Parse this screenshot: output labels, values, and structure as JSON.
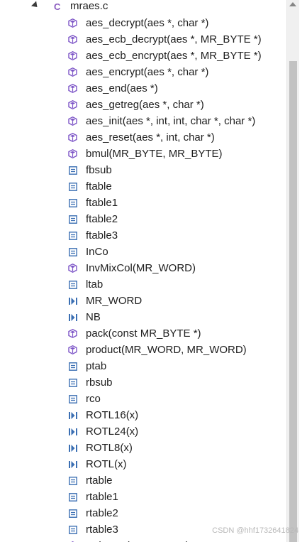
{
  "file": {
    "name": "mraes.c",
    "icon": "c-file-icon"
  },
  "colors": {
    "function": "#7d55c7",
    "variable": "#3b6fb3",
    "macro": "#3b6fb3"
  },
  "items": [
    {
      "label": "aes_decrypt(aes *, char *)",
      "kind": "function"
    },
    {
      "label": "aes_ecb_decrypt(aes *, MR_BYTE *)",
      "kind": "function"
    },
    {
      "label": "aes_ecb_encrypt(aes *, MR_BYTE *)",
      "kind": "function"
    },
    {
      "label": "aes_encrypt(aes *, char *)",
      "kind": "function"
    },
    {
      "label": "aes_end(aes *)",
      "kind": "function"
    },
    {
      "label": "aes_getreg(aes *, char *)",
      "kind": "function"
    },
    {
      "label": "aes_init(aes *, int, int, char *, char *)",
      "kind": "function"
    },
    {
      "label": "aes_reset(aes *, int, char *)",
      "kind": "function"
    },
    {
      "label": "bmul(MR_BYTE, MR_BYTE)",
      "kind": "function"
    },
    {
      "label": "fbsub",
      "kind": "variable"
    },
    {
      "label": "ftable",
      "kind": "variable"
    },
    {
      "label": "ftable1",
      "kind": "variable"
    },
    {
      "label": "ftable2",
      "kind": "variable"
    },
    {
      "label": "ftable3",
      "kind": "variable"
    },
    {
      "label": "InCo",
      "kind": "variable"
    },
    {
      "label": "InvMixCol(MR_WORD)",
      "kind": "function"
    },
    {
      "label": "ltab",
      "kind": "variable"
    },
    {
      "label": "MR_WORD",
      "kind": "macro"
    },
    {
      "label": "NB",
      "kind": "macro"
    },
    {
      "label": "pack(const MR_BYTE *)",
      "kind": "function"
    },
    {
      "label": "product(MR_WORD, MR_WORD)",
      "kind": "function"
    },
    {
      "label": "ptab",
      "kind": "variable"
    },
    {
      "label": "rbsub",
      "kind": "variable"
    },
    {
      "label": "rco",
      "kind": "variable"
    },
    {
      "label": "ROTL16(x)",
      "kind": "macro"
    },
    {
      "label": "ROTL24(x)",
      "kind": "macro"
    },
    {
      "label": "ROTL8(x)",
      "kind": "macro"
    },
    {
      "label": "ROTL(x)",
      "kind": "macro"
    },
    {
      "label": "rtable",
      "kind": "variable"
    },
    {
      "label": "rtable1",
      "kind": "variable"
    },
    {
      "label": "rtable2",
      "kind": "variable"
    },
    {
      "label": "rtable3",
      "kind": "variable"
    },
    {
      "label": "SubByte(MR_WORD)",
      "kind": "function"
    }
  ],
  "watermark": "CSDN @hhf1732641824"
}
